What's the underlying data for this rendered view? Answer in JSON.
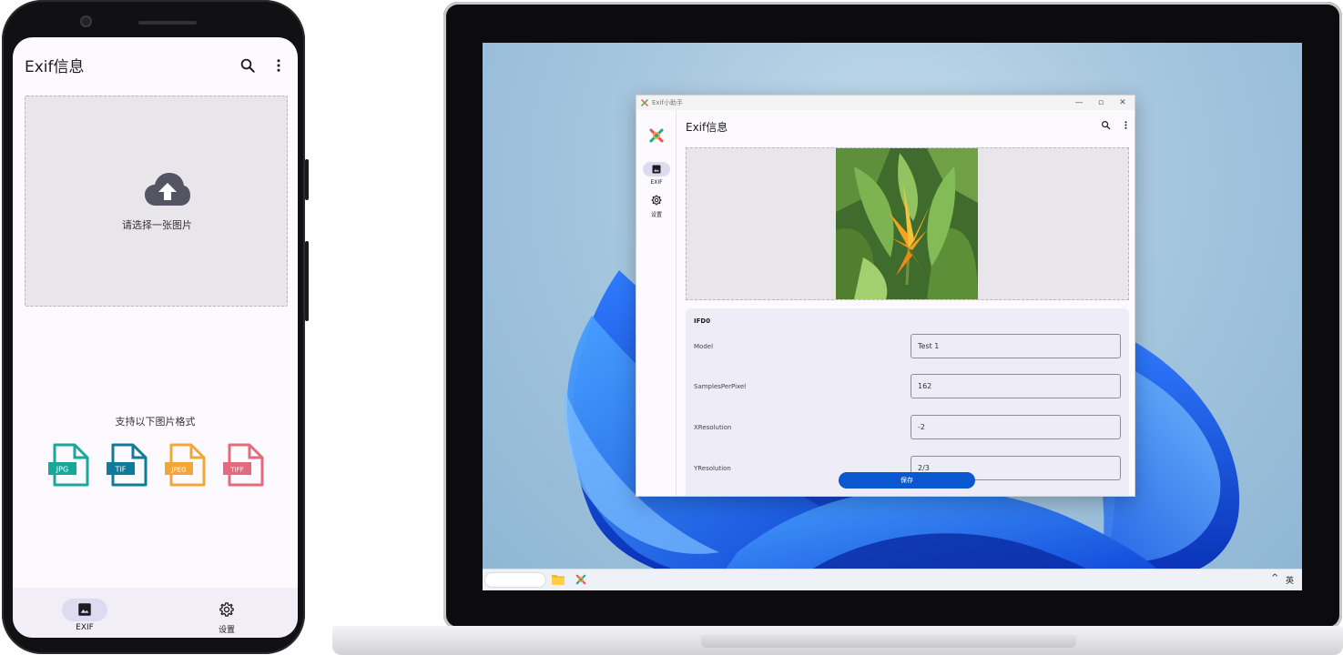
{
  "phone": {
    "app_title": "Exif信息",
    "upload_prompt": "请选择一张图片",
    "supported_formats_label": "支持以下图片格式",
    "formats": [
      {
        "label": "JPG",
        "color": "#1aa79b"
      },
      {
        "label": "TIF",
        "color": "#0f7b9a"
      },
      {
        "label": "JPEG",
        "color": "#f2a63a"
      },
      {
        "label": "TIFF",
        "color": "#e36b7b"
      }
    ],
    "bottom_nav": {
      "exif_label": "EXIF",
      "settings_label": "设置"
    }
  },
  "desktop_window": {
    "window_title": "Exif小助手",
    "heading": "Exif信息",
    "nav": {
      "exif_label": "EXIF",
      "settings_label": "设置"
    },
    "section_title": "IFD0",
    "fields": [
      {
        "label": "Model",
        "value": "Test 1"
      },
      {
        "label": "SamplesPerPixel",
        "value": "162"
      },
      {
        "label": "XResolution",
        "value": "-2"
      },
      {
        "label": "YResolution",
        "value": "2/3"
      }
    ],
    "save_label": "保存",
    "accent_color": "#0b57d0"
  },
  "taskbar": {
    "ime_indicator": "英",
    "chevron": "^"
  }
}
